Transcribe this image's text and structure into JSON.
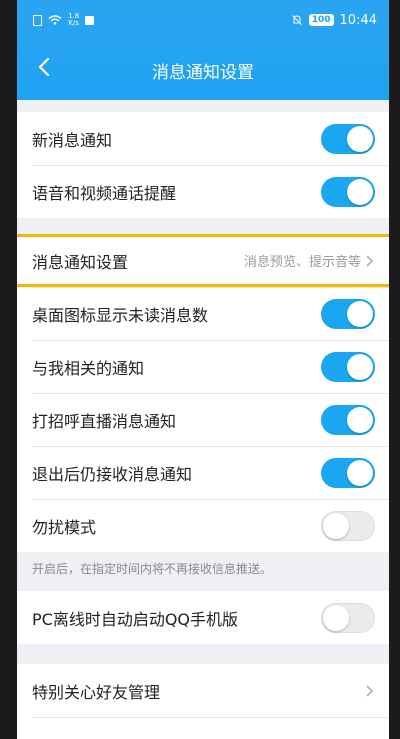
{
  "status_bar": {
    "network_speed_value": "1.8",
    "network_speed_unit": "K/s",
    "battery": "100",
    "time": "10:44"
  },
  "header": {
    "title": "消息通知设置"
  },
  "section1": [
    {
      "label": "新消息通知",
      "toggle": "on"
    },
    {
      "label": "语音和视频通话提醒",
      "toggle": "on"
    }
  ],
  "section2": {
    "nav_row": {
      "label": "消息通知设置",
      "detail": "消息预览、提示音等"
    },
    "toggles": [
      {
        "label": "桌面图标显示未读消息数",
        "toggle": "on"
      },
      {
        "label": "与我相关的通知",
        "toggle": "on"
      },
      {
        "label": "打招呼直播消息通知",
        "toggle": "on"
      },
      {
        "label": "退出后仍接收消息通知",
        "toggle": "on"
      },
      {
        "label": "勿扰模式",
        "toggle": "off"
      }
    ],
    "note": "开启后，在指定时间内将不再接收信息推送。"
  },
  "section3": {
    "label": "PC离线时自动启动QQ手机版",
    "toggle": "off"
  },
  "section4": {
    "label": "特别关心好友管理"
  },
  "colors": {
    "accent": "#1aa6f1",
    "highlight": "#f5b800"
  }
}
